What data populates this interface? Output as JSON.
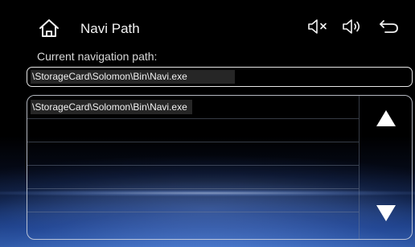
{
  "header": {
    "title": "Navi Path",
    "icons": [
      "home-icon",
      "mute-icon",
      "volume-icon",
      "back-icon"
    ]
  },
  "current_path": {
    "label": "Current navigation path:",
    "value": "\\StorageCard\\Solomon\\Bin\\Navi.exe"
  },
  "file_list": {
    "items": [
      {
        "text": "\\StorageCard\\Solomon\\Bin\\Navi.exe"
      },
      {
        "text": ""
      },
      {
        "text": ""
      },
      {
        "text": ""
      },
      {
        "text": ""
      },
      {
        "text": ""
      }
    ]
  },
  "scroll": {
    "up_icon": "triangle-up-icon",
    "down_icon": "triangle-down-icon"
  },
  "colors": {
    "text": "#f0f0f0",
    "selection": "#262626",
    "border": "#e6e6e6"
  }
}
